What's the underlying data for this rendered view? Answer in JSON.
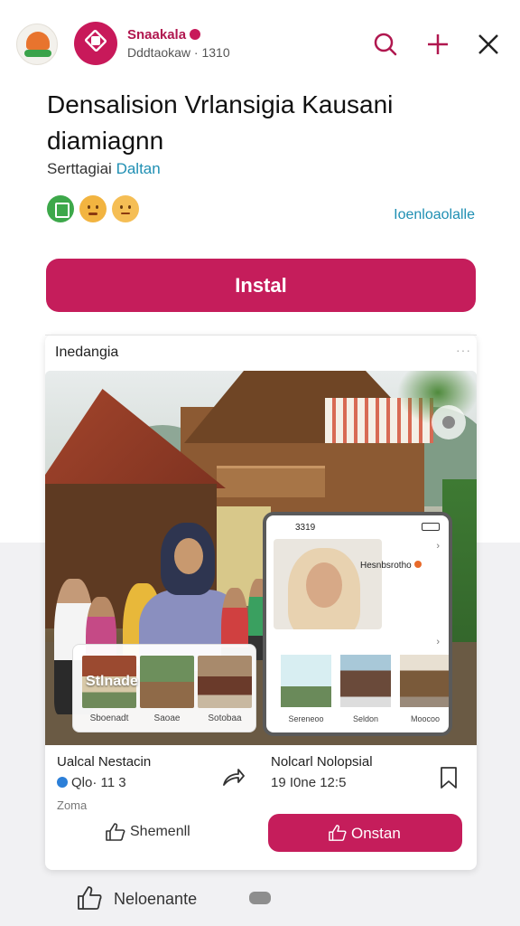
{
  "header": {
    "brand_name": "Snaakala",
    "brand_sub": "Dddtaokaw · 1310"
  },
  "listing": {
    "title": "Densalision Vrlansigia Kausani diamiagnn",
    "subtitle_prefix": "Serttagiai",
    "subtitle_link": "Daltan",
    "side_link": "Ioenloaolalle",
    "install_label": "Instal"
  },
  "card": {
    "header_label": "Inedangia",
    "dots": "···",
    "gallery": {
      "overlay_text": "Stlnade",
      "labels": [
        "Sboenadt",
        "Saoae",
        "Sotobaa"
      ]
    },
    "phone": {
      "status": "3319",
      "name": "Hesnbsrotho",
      "labels": [
        "Sereneoo",
        "Seldon",
        "Moocoo"
      ]
    },
    "left": {
      "title": "Ualcal Nestacin",
      "meta": "Qlo· 11 3",
      "zone": "Zoma"
    },
    "right": {
      "title": "Nolcarl Nolopsial",
      "meta": "19 I0ne 12:5"
    },
    "share_label": "Shemenll",
    "onstan_label": "Onstan"
  },
  "footer": {
    "like_label": "Neloenante"
  },
  "colors": {
    "accent": "#c51d5b",
    "brand_text": "#b0174f",
    "link": "#1f8fb3"
  },
  "icons": [
    "app-logo-icon",
    "search-icon",
    "plus-icon",
    "close-icon",
    "share-icon",
    "bookmark-icon",
    "thumbs-up-icon"
  ]
}
